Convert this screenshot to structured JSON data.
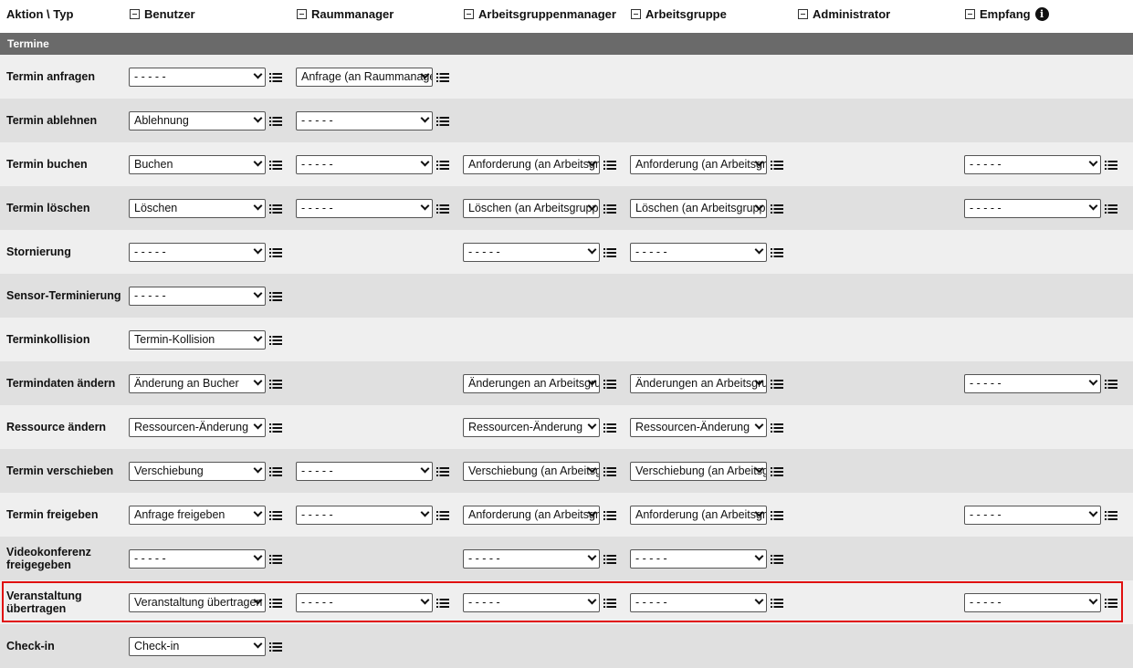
{
  "columns": {
    "action": "Aktion \\ Typ",
    "benutzer": "Benutzer",
    "raummanager": "Raummanager",
    "arbeitsgruppenmanager": "Arbeitsgruppenmanager",
    "arbeitsgruppe": "Arbeitsgruppe",
    "administrator": "Administrator",
    "empfang": "Empfang"
  },
  "section": {
    "title": "Termine"
  },
  "icons": {
    "collapse": "collapse-minus-icon",
    "info": "info-icon",
    "list": "list-icon",
    "dropdown": "chevron-down-icon"
  },
  "colors": {
    "section_bar": "#6a6a6a",
    "highlight": "#e01010",
    "row_light": "#efefef",
    "row_dark": "#e0e0e0"
  },
  "rows": [
    {
      "label": "Termin anfragen",
      "benutzer": "- - - - -",
      "raummanager": "Anfrage (an Raummanager)",
      "arbeitsgruppenmanager": null,
      "arbeitsgruppe": null,
      "administrator": null,
      "empfang": null
    },
    {
      "label": "Termin ablehnen",
      "benutzer": "Ablehnung",
      "raummanager": "- - - - -",
      "arbeitsgruppenmanager": null,
      "arbeitsgruppe": null,
      "administrator": null,
      "empfang": null
    },
    {
      "label": "Termin buchen",
      "benutzer": "Buchen",
      "raummanager": "- - - - -",
      "arbeitsgruppenmanager": "Anforderung (an Arbeitsgruppe)",
      "arbeitsgruppe": "Anforderung (an Arbeitsgruppe)",
      "administrator": null,
      "empfang": "- - - - -"
    },
    {
      "label": "Termin löschen",
      "benutzer": "Löschen",
      "raummanager": "- - - - -",
      "arbeitsgruppenmanager": "Löschen (an Arbeitsgruppe)",
      "arbeitsgruppe": "Löschen (an Arbeitsgruppe)",
      "administrator": null,
      "empfang": "- - - - -"
    },
    {
      "label": "Stornierung",
      "benutzer": "- - - - -",
      "raummanager": null,
      "arbeitsgruppenmanager": "- - - - -",
      "arbeitsgruppe": "- - - - -",
      "administrator": null,
      "empfang": null
    },
    {
      "label": "Sensor-Terminierung",
      "benutzer": "- - - - -",
      "raummanager": null,
      "arbeitsgruppenmanager": null,
      "arbeitsgruppe": null,
      "administrator": null,
      "empfang": null
    },
    {
      "label": "Terminkollision",
      "benutzer": "Termin-Kollision",
      "raummanager": null,
      "arbeitsgruppenmanager": null,
      "arbeitsgruppe": null,
      "administrator": null,
      "empfang": null
    },
    {
      "label": "Termindaten ändern",
      "benutzer": "Änderung an Bucher",
      "raummanager": null,
      "arbeitsgruppenmanager": "Änderungen an Arbeitsgruppe",
      "arbeitsgruppe": "Änderungen an Arbeitsgruppe",
      "administrator": null,
      "empfang": "- - - - -"
    },
    {
      "label": "Ressource ändern",
      "benutzer": "Ressourcen-Änderung",
      "raummanager": null,
      "arbeitsgruppenmanager": "Ressourcen-Änderung",
      "arbeitsgruppe": "Ressourcen-Änderung",
      "administrator": null,
      "empfang": null
    },
    {
      "label": "Termin verschieben",
      "benutzer": "Verschiebung",
      "raummanager": "- - - - -",
      "arbeitsgruppenmanager": "Verschiebung (an Arbeitsgruppe)",
      "arbeitsgruppe": "Verschiebung (an Arbeitsgruppe)",
      "administrator": null,
      "empfang": null
    },
    {
      "label": "Termin freigeben",
      "benutzer": "Anfrage freigeben",
      "raummanager": "- - - - -",
      "arbeitsgruppenmanager": "Anforderung (an Arbeitsgruppe)",
      "arbeitsgruppe": "Anforderung (an Arbeitsgruppe)",
      "administrator": null,
      "empfang": "- - - - -"
    },
    {
      "label": "Videokonferenz freigegeben",
      "benutzer": "- - - - -",
      "raummanager": null,
      "arbeitsgruppenmanager": "- - - - -",
      "arbeitsgruppe": "- - - - -",
      "administrator": null,
      "empfang": null
    },
    {
      "label": "Veranstaltung übertragen",
      "benutzer": "Veranstaltung übertragen",
      "raummanager": "- - - - -",
      "arbeitsgruppenmanager": "- - - - -",
      "arbeitsgruppe": "- - - - -",
      "administrator": null,
      "empfang": "- - - - -",
      "highlighted": true
    },
    {
      "label": "Check-in",
      "benutzer": "Check-in",
      "raummanager": null,
      "arbeitsgruppenmanager": null,
      "arbeitsgruppe": null,
      "administrator": null,
      "empfang": null
    }
  ]
}
